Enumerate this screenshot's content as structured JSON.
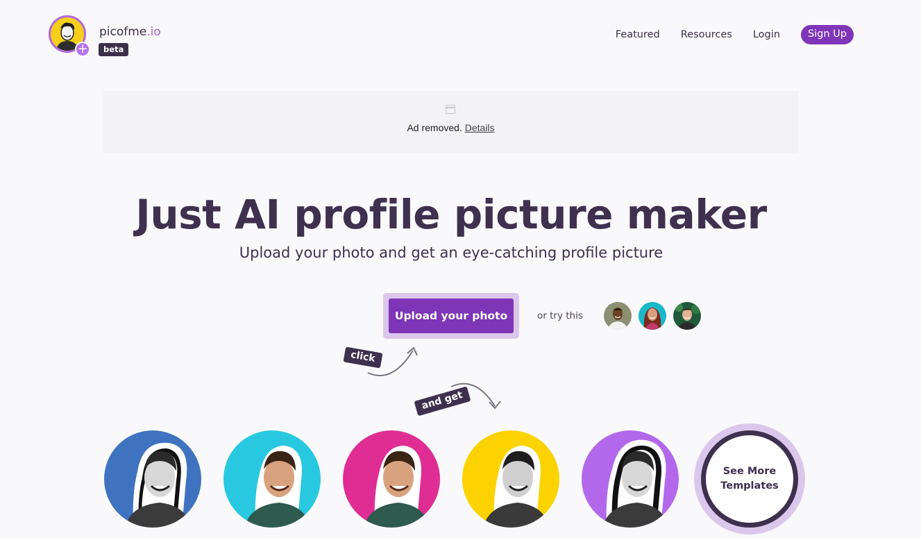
{
  "header": {
    "brand_main": "picofme",
    "brand_tld": ".io",
    "beta_label": "beta",
    "nav": [
      {
        "label": "Featured"
      },
      {
        "label": "Resources"
      },
      {
        "label": "Login"
      },
      {
        "label": "Sign Up"
      }
    ]
  },
  "ad": {
    "text": "Ad removed.",
    "link": "Details",
    "icon": "ad-icon"
  },
  "hero": {
    "title": "Just AI profile picture maker",
    "subtitle": "Upload your photo and get an eye-catching profile picture",
    "upload_label": "Upload your photo",
    "or_try": "or try this",
    "click_tag": "click",
    "and_get_tag": "and get"
  },
  "samples": [
    {
      "name": "sample-1",
      "bg": "#8c8f72"
    },
    {
      "name": "sample-2",
      "bg": "#19b9c9"
    },
    {
      "name": "sample-3",
      "bg": "#1f5a3a"
    }
  ],
  "templates": [
    {
      "bg": "#3f73c0"
    },
    {
      "bg": "#28c8e0"
    },
    {
      "bg": "#df2d93"
    },
    {
      "bg": "#fcd300"
    },
    {
      "bg": "#b368ec"
    }
  ],
  "see_more": {
    "line1": "See More",
    "line2": "Templates"
  },
  "colors": {
    "accent": "#7e35b8",
    "accent_light": "#dcc7ec",
    "text_dark": "#3f304f",
    "logo_ring": "#b266e0"
  }
}
